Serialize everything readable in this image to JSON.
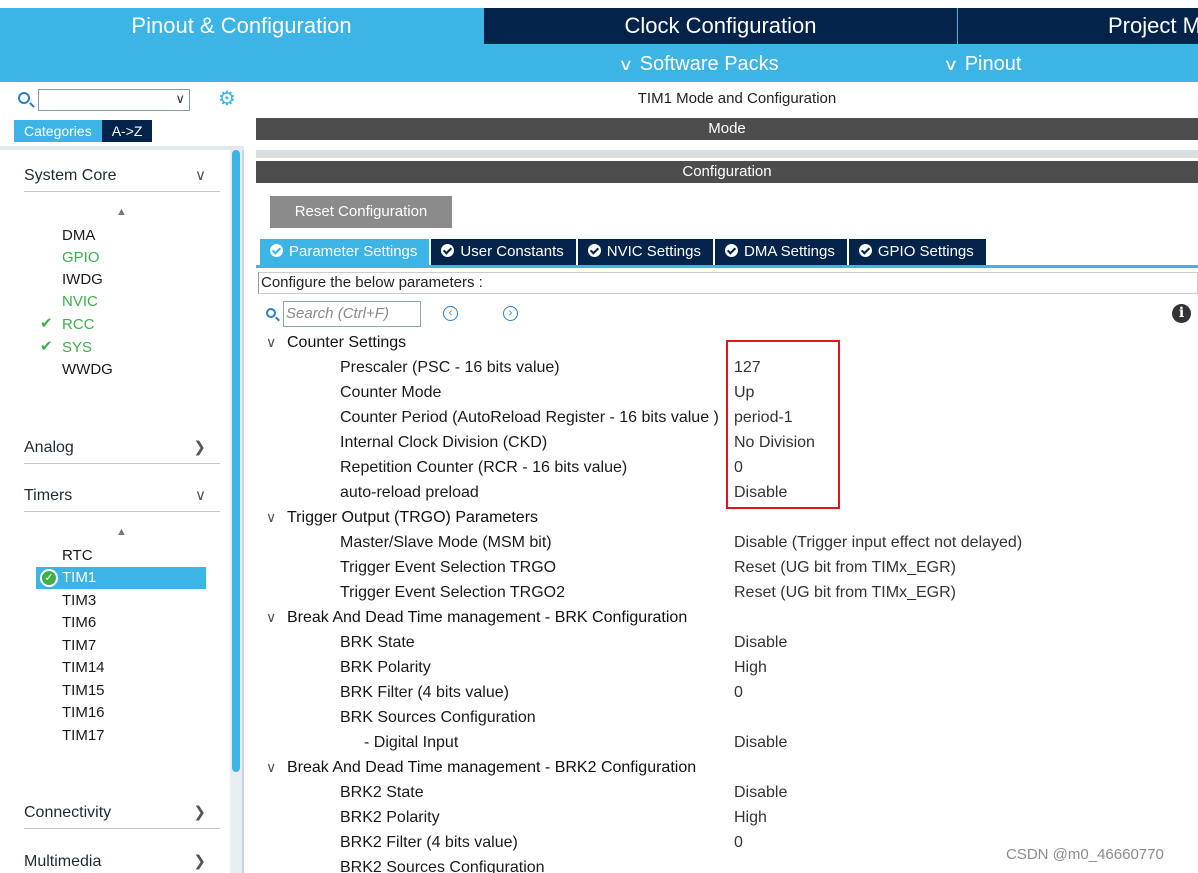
{
  "top_tabs": [
    {
      "label": "Pinout & Configuration",
      "active": true
    },
    {
      "label": "Clock Configuration",
      "active": false
    },
    {
      "label": "Project M",
      "active": false
    }
  ],
  "sub_menu": [
    {
      "label": "Software Packs",
      "icon": "chevron-down-icon"
    },
    {
      "label": "Pinout",
      "icon": "chevron-down-icon"
    }
  ],
  "left_panel": {
    "search_value": "",
    "category_tabs": [
      "Categories",
      "A->Z"
    ],
    "categories": [
      {
        "label": "System Core",
        "expanded": true,
        "items": [
          {
            "label": "DMA",
            "status": "none"
          },
          {
            "label": "GPIO",
            "status": "ok"
          },
          {
            "label": "IWDG",
            "status": "none"
          },
          {
            "label": "NVIC",
            "status": "ok"
          },
          {
            "label": "RCC",
            "status": "checked"
          },
          {
            "label": "SYS",
            "status": "checked"
          },
          {
            "label": "WWDG",
            "status": "none"
          }
        ]
      },
      {
        "label": "Analog",
        "expanded": false
      },
      {
        "label": "Timers",
        "expanded": true,
        "items": [
          {
            "label": "RTC",
            "status": "none"
          },
          {
            "label": "TIM1",
            "status": "selected"
          },
          {
            "label": "TIM3",
            "status": "none"
          },
          {
            "label": "TIM6",
            "status": "none"
          },
          {
            "label": "TIM7",
            "status": "none"
          },
          {
            "label": "TIM14",
            "status": "none"
          },
          {
            "label": "TIM15",
            "status": "none"
          },
          {
            "label": "TIM16",
            "status": "none"
          },
          {
            "label": "TIM17",
            "status": "none"
          }
        ]
      },
      {
        "label": "Connectivity",
        "expanded": false
      },
      {
        "label": "Multimedia",
        "expanded": false
      }
    ]
  },
  "right_panel": {
    "title": "TIM1 Mode and Configuration",
    "mode_bar": "Mode",
    "config_bar": "Configuration",
    "reset_button": "Reset Configuration",
    "param_tabs": [
      "Parameter Settings",
      "User Constants",
      "NVIC Settings",
      "DMA Settings",
      "GPIO Settings"
    ],
    "hint": "Configure the below parameters :",
    "search_placeholder": "Search (Ctrl+F)",
    "groups": [
      {
        "label": "Counter Settings",
        "params": [
          {
            "name": "Prescaler (PSC - 16 bits value)",
            "value": "127"
          },
          {
            "name": "Counter Mode",
            "value": "Up"
          },
          {
            "name": "Counter Period (AutoReload Register - 16 bits value )",
            "value": "period-1"
          },
          {
            "name": "Internal Clock Division (CKD)",
            "value": "No Division"
          },
          {
            "name": "Repetition Counter (RCR - 16 bits value)",
            "value": "0"
          },
          {
            "name": "auto-reload preload",
            "value": "Disable"
          }
        ]
      },
      {
        "label": "Trigger Output (TRGO) Parameters",
        "params": [
          {
            "name": "Master/Slave Mode (MSM bit)",
            "value": "Disable (Trigger input effect not delayed)"
          },
          {
            "name": "Trigger Event Selection TRGO",
            "value": "Reset (UG bit from TIMx_EGR)"
          },
          {
            "name": "Trigger Event Selection TRGO2",
            "value": "Reset (UG bit from TIMx_EGR)"
          }
        ]
      },
      {
        "label": "Break And Dead Time management - BRK Configuration",
        "params": [
          {
            "name": "BRK State",
            "value": "Disable"
          },
          {
            "name": "BRK Polarity",
            "value": "High"
          },
          {
            "name": "BRK Filter (4 bits value)",
            "value": "0"
          },
          {
            "name": "BRK Sources Configuration",
            "value": ""
          },
          {
            "name": "- Digital Input",
            "value": "Disable",
            "sub": true
          }
        ]
      },
      {
        "label": "Break And Dead Time management - BRK2 Configuration",
        "params": [
          {
            "name": "BRK2 State",
            "value": "Disable"
          },
          {
            "name": "BRK2 Polarity",
            "value": "High"
          },
          {
            "name": "BRK2 Filter (4 bits value)",
            "value": "0"
          },
          {
            "name": "BRK2 Sources Configuration",
            "value": ""
          }
        ]
      }
    ]
  },
  "watermark": "CSDN @m0_46660770",
  "colors": {
    "accent": "#3cb4e6",
    "navy": "#03234b",
    "ok_green": "#3fae49",
    "highlight_red": "#e0161e"
  }
}
